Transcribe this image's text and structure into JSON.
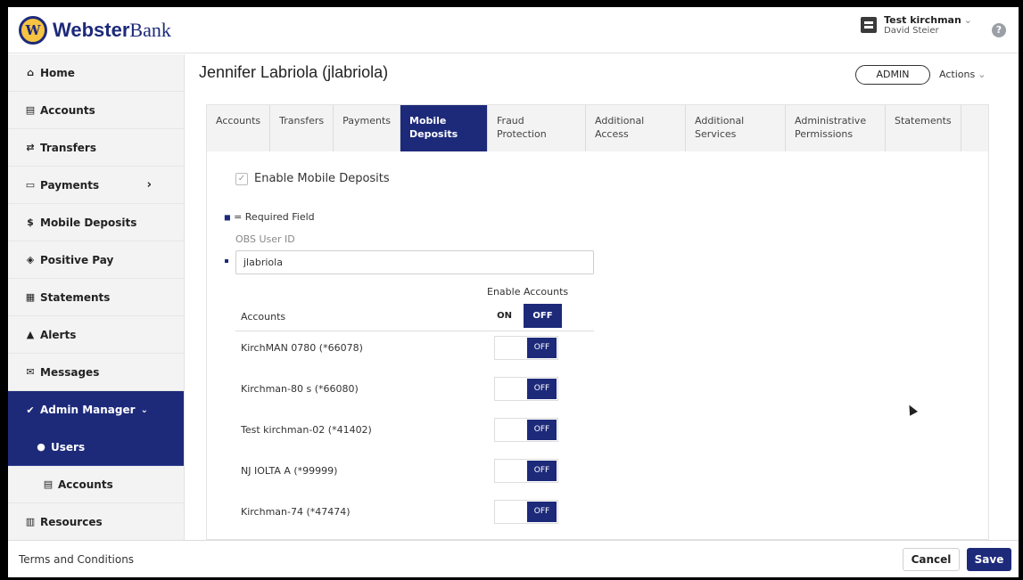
{
  "brand": {
    "logo_letter": "W",
    "name_bold": "Webster",
    "name_light": "Bank"
  },
  "user": {
    "name": "Test kirchman",
    "sub": "David Steier"
  },
  "sidebar": {
    "items": [
      {
        "label": "Home",
        "icon": "home-icon"
      },
      {
        "label": "Accounts",
        "icon": "accounts-icon"
      },
      {
        "label": "Transfers",
        "icon": "transfers-icon"
      },
      {
        "label": "Payments",
        "icon": "payments-icon"
      },
      {
        "label": "Mobile Deposits",
        "icon": "dollar-icon"
      },
      {
        "label": "Positive Pay",
        "icon": "shield-icon"
      },
      {
        "label": "Statements",
        "icon": "document-icon"
      },
      {
        "label": "Alerts",
        "icon": "bell-icon"
      },
      {
        "label": "Messages",
        "icon": "envelope-icon"
      },
      {
        "label": "Admin Manager",
        "icon": "check-circle-icon"
      },
      {
        "label": "Users",
        "icon": "user-icon"
      },
      {
        "label": "Accounts",
        "icon": "accounts-icon"
      },
      {
        "label": "Resources",
        "icon": "resources-icon"
      }
    ]
  },
  "page": {
    "title": "Jennifer Labriola (jlabriola)",
    "role_badge": "ADMIN",
    "actions_label": "Actions"
  },
  "tabs": [
    {
      "line1": "Accounts",
      "line2": ""
    },
    {
      "line1": "Transfers",
      "line2": ""
    },
    {
      "line1": "Payments",
      "line2": ""
    },
    {
      "line1": "Mobile",
      "line2": "Deposits"
    },
    {
      "line1": "Fraud",
      "line2": "Protection"
    },
    {
      "line1": "Additional",
      "line2": "Access"
    },
    {
      "line1": "Additional",
      "line2": "Services"
    },
    {
      "line1": "Administrative",
      "line2": "Permissions"
    },
    {
      "line1": "Statements",
      "line2": ""
    }
  ],
  "form": {
    "enable_mobile_label": "Enable Mobile Deposits",
    "required_text": "= Required Field",
    "obs_label": "OBS User ID",
    "obs_value": "jlabriola",
    "enable_accounts_label": "Enable Accounts",
    "on_label": "ON",
    "off_label": "OFF",
    "accounts_header": "Accounts"
  },
  "accounts": [
    {
      "name": "KirchMAN 0780 (*66078)",
      "state": "OFF"
    },
    {
      "name": "Kirchman-80 s (*66080)",
      "state": "OFF"
    },
    {
      "name": "Test kirchman-02 (*41402)",
      "state": "OFF"
    },
    {
      "name": "NJ IOLTA A (*99999)",
      "state": "OFF"
    },
    {
      "name": "Kirchman-74 (*47474)",
      "state": "OFF"
    }
  ],
  "footer": {
    "terms": "Terms and Conditions",
    "cancel": "Cancel",
    "save": "Save"
  },
  "colors": {
    "brand_navy": "#1d2a7a",
    "logo_gold": "#f6c342"
  }
}
